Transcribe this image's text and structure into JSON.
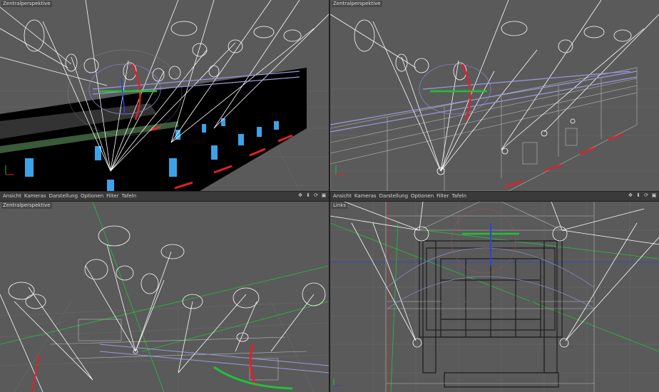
{
  "menubar": {
    "items": [
      "Ansicht",
      "Kameras",
      "Darstellung",
      "Optionen",
      "Filter",
      "Tafeln"
    ],
    "icons": [
      "move-icon",
      "arrow-down-icon",
      "refresh-icon",
      "maximize-icon"
    ],
    "icon_glyphs": [
      "✥",
      "⬇",
      "⟳",
      "▣"
    ]
  },
  "viewports": {
    "top_left": {
      "label": "Zentralperspektive"
    },
    "top_right": {
      "label": "Zentralperspektive"
    },
    "bottom_left": {
      "label": "Zentralperspektive"
    },
    "bottom_right": {
      "label": "Links"
    }
  },
  "colors": {
    "viewport_bg": "#5a5a5a",
    "wire": "#ffffff",
    "accent_red": "#e0202a",
    "accent_green": "#22c03a",
    "accent_blue": "#2a44d8",
    "light_blue": "#3ea2e8"
  }
}
